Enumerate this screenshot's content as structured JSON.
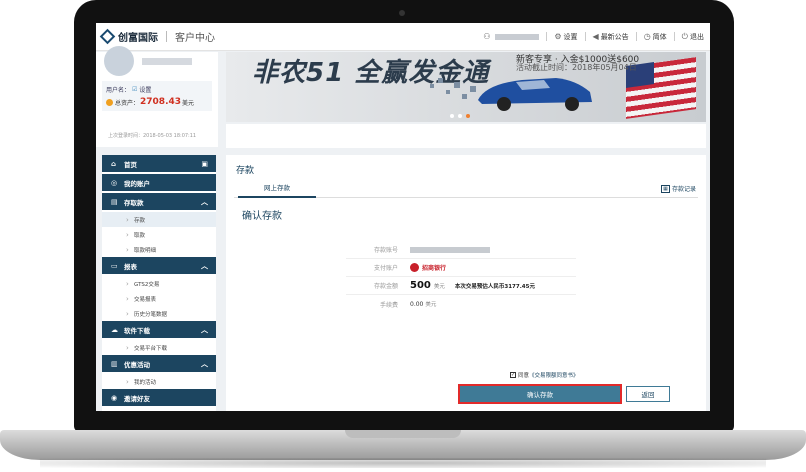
{
  "header": {
    "brand": "创富国际",
    "section": "客户中心",
    "settings": "设置",
    "announcements": "最新公告",
    "language": "简体",
    "logout": "退出"
  },
  "profile": {
    "username_label": "用户名：",
    "settings_link": "设置",
    "assets_label": "总资产：",
    "assets_value": "2708.43",
    "assets_unit": "美元",
    "last_login": "上次登录时间：2018-05-03 18:07:11"
  },
  "banner": {
    "headline": "非农51 全赢发金通",
    "promo_line1": "新客专享 · 入金$1000送$600",
    "promo_line2": "活动截止时间：2018年05月04日"
  },
  "sidenav": {
    "home": "首页",
    "my_account": "我的账户",
    "deposit_withdraw": "存取款",
    "deposit": "存款",
    "withdraw": "取款",
    "withdraw_detail": "取款明细",
    "reports": "报表",
    "gts2": "GTS2交易",
    "trade_report": "交易报表",
    "history_split": "历史分笔数据",
    "software": "软件下载",
    "platform_download": "交易平台下载",
    "promotions": "优惠活动",
    "my_activities": "我的活动",
    "invite": "邀请好友"
  },
  "main": {
    "page_title": "存款",
    "tab_online": "网上存款",
    "history_link": "存款记录",
    "confirm_title": "确认存款",
    "rows": {
      "account_label": "存款账号",
      "pay_label": "支付账户",
      "bank_name": "招商银行",
      "amount_label": "存款金额",
      "amount_value": "500",
      "amount_unit": "美元",
      "rmb_estimate": "本次交易预估人民币3177.45元",
      "fee_label": "手续费",
      "fee_value": "0.00",
      "fee_unit": "美元"
    },
    "agree_prefix": "同意",
    "agreement_link": "《交易限额同意书》",
    "confirm_button": "确认存款",
    "back_button": "返回"
  },
  "colors": {
    "nav_dark": "#1c4560",
    "button_blue": "#3f7a96",
    "highlight_red": "#e22a2a",
    "assets_red": "#d03020"
  }
}
